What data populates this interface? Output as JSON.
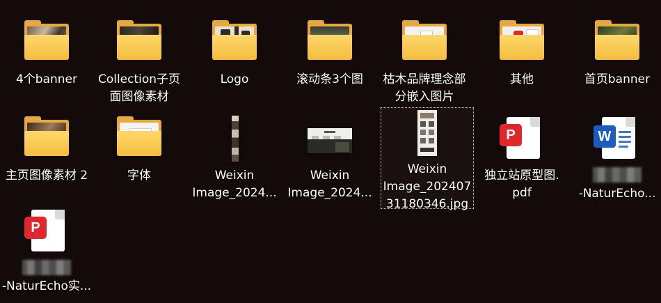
{
  "desktop": {
    "items": [
      {
        "label": "4个banner",
        "type": "folder",
        "icon": "folder-icon"
      },
      {
        "label": "Collection子页面图像素材",
        "type": "folder",
        "icon": "folder-icon"
      },
      {
        "label": "Logo",
        "type": "folder",
        "icon": "folder-icon"
      },
      {
        "label": "滚动条3个图",
        "type": "folder",
        "icon": "folder-icon"
      },
      {
        "label": "枯木品牌理念部分嵌入图片",
        "type": "folder",
        "icon": "folder-icon"
      },
      {
        "label": "其他",
        "type": "folder",
        "icon": "folder-icon"
      },
      {
        "label": "首页banner",
        "type": "folder",
        "icon": "folder-icon"
      },
      {
        "label": "主页图像素材 2",
        "type": "folder",
        "icon": "folder-icon"
      },
      {
        "label": "字体",
        "type": "folder",
        "icon": "folder-icon"
      },
      {
        "label": "Weixin Image_2024...",
        "type": "image",
        "icon": "image-thumbnail-icon"
      },
      {
        "label": "Weixin Image_2024...",
        "type": "image",
        "icon": "image-thumbnail-icon"
      },
      {
        "label": "Weixin Image_20240731180346.jpg",
        "type": "image",
        "icon": "image-thumbnail-icon",
        "selected": true
      },
      {
        "label": "独立站原型图.pdf",
        "type": "pdf",
        "icon": "pdf-icon"
      },
      {
        "label": "-NaturEcho...",
        "type": "word",
        "icon": "word-doc-icon"
      },
      {
        "label": "-NaturEcho实...",
        "type": "pdf",
        "icon": "pdf-icon"
      }
    ]
  },
  "labels": {
    "i0": [
      "4个banner"
    ],
    "i1": [
      "Collection子页",
      "面图像素材"
    ],
    "i2": [
      "Logo"
    ],
    "i3": [
      "滚动条3个图"
    ],
    "i4": [
      "枯木品牌理念部",
      "分嵌入图片"
    ],
    "i5": [
      "其他"
    ],
    "i6": [
      "首页banner"
    ],
    "i7": [
      "主页图像素材 2"
    ],
    "i8": [
      "字体"
    ],
    "i9": [
      "Weixin",
      "Image_2024..."
    ],
    "i10": [
      "Weixin",
      "Image_2024..."
    ],
    "i11": [
      "Weixin",
      "Image_202407",
      "31180346.jpg"
    ],
    "i12": [
      "独立站原型图.",
      "pdf"
    ],
    "i13": [
      "-NaturEcho..."
    ],
    "i14": [
      "-NaturEcho实..."
    ]
  },
  "badges": {
    "pdf_glyph": "P",
    "word_glyph": "W"
  },
  "colors": {
    "background": "#130b09",
    "folder_front": "#f3bd3e",
    "folder_back": "#e7a93b",
    "pdf_red": "#e0272e",
    "word_blue": "#1a5dbf",
    "label_text": "#ffffff"
  }
}
